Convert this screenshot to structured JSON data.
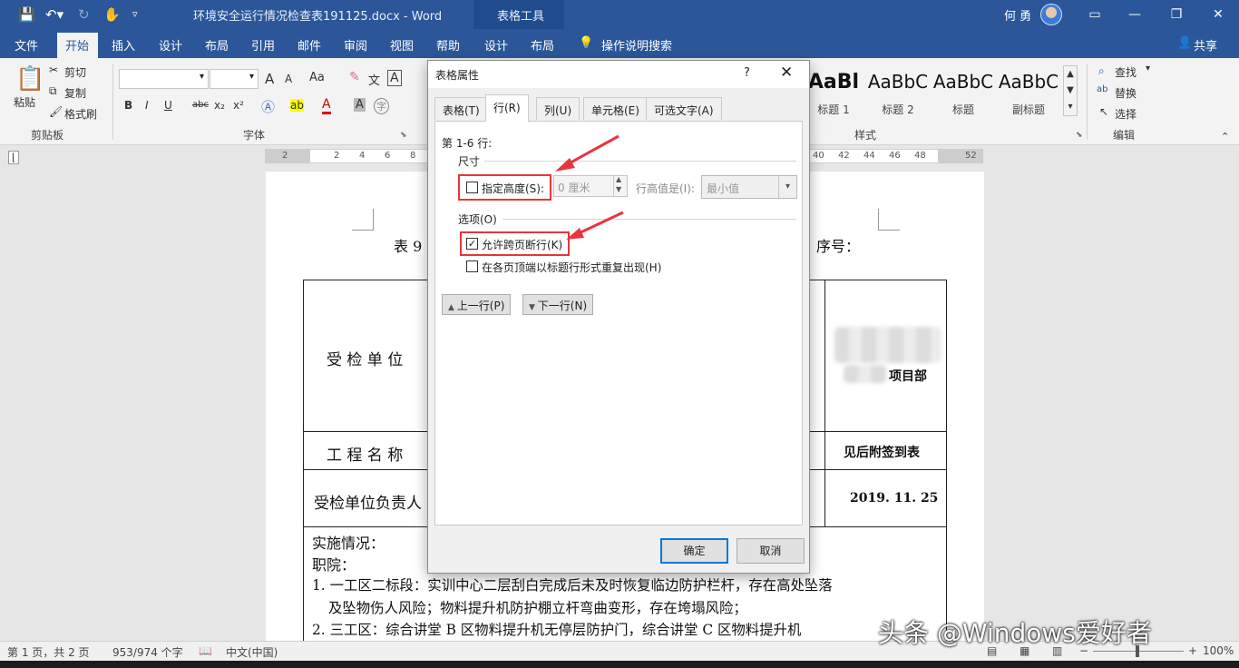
{
  "titlebar": {
    "doc_title": "环境安全运行情况检查表191125.docx  -  Word",
    "table_tools": "表格工具",
    "user_name": "何 勇"
  },
  "tabs": [
    "文件",
    "开始",
    "插入",
    "设计",
    "布局",
    "引用",
    "邮件",
    "审阅",
    "视图",
    "帮助",
    "设计",
    "布局",
    "操作说明搜索"
  ],
  "share_label": "共享",
  "ribbon": {
    "clipboard": {
      "paste": "粘贴",
      "cut": "剪切",
      "copy": "复制",
      "format_painter": "格式刷",
      "label": "剪贴板"
    },
    "font": {
      "label": "字体",
      "bold": "B",
      "italic": "I",
      "underline": "U",
      "strike": "abc",
      "sub": "x₂",
      "sup": "x²",
      "case": "Aa",
      "grow": "A",
      "shrink": "A",
      "font_color": "A",
      "highlight": "ab",
      "char_shade": "A",
      "char_border": "A",
      "phonetic": "文",
      "enclose": "字"
    },
    "styles": {
      "label": "样式",
      "items": [
        {
          "sample": "AaBl",
          "name": "标题 1"
        },
        {
          "sample": "AaBbC",
          "name": "标题 2"
        },
        {
          "sample": "AaBbC",
          "name": "标题"
        },
        {
          "sample": "AaBbC",
          "name": "副标题"
        }
      ]
    },
    "editing": {
      "find": "查找",
      "replace": "替换",
      "select": "选择",
      "label": "编辑"
    }
  },
  "ruler": {
    "left_numbers": [
      "2",
      "2",
      "4",
      "6",
      "8"
    ],
    "right_numbers": [
      "40",
      "42",
      "44",
      "46",
      "48",
      "52"
    ]
  },
  "document": {
    "title_left": "表 9",
    "title_right": "序号：",
    "row1_label": "受 检 单 位",
    "row1_value": "项目部",
    "row2_label": "工 程 名 称",
    "row2_value": "见后附签到表",
    "row3_label": "受检单位负责人",
    "row3_value": "2019. 11. 25",
    "body_lines": [
      "实施情况：",
      "职院：",
      "1. 一工区二标段：实训中心二层刮白完成后未及时恢复临边防护栏杆，存在高处坠落",
      "及坠物伤人风险；物料提升机防护棚立杆弯曲变形，存在垮塌风险；",
      "2. 三工区：综合讲堂 B 区物料提升机无停层防护门，综合讲堂 C 区物料提升机"
    ]
  },
  "dialog": {
    "title": "表格属性",
    "help": "?",
    "tabs": [
      "表格(T)",
      "行(R)",
      "列(U)",
      "单元格(E)",
      "可选文字(A)"
    ],
    "rows_header": "第 1-6 行:",
    "size_label": "尺寸",
    "specify_height": "指定高度(S):",
    "specify_height_checked": false,
    "height_value": "0 厘米",
    "row_height_is": "行高值是(I):",
    "row_height_rule": "最小值",
    "options_label": "选项(O)",
    "allow_break": "允许跨页断行(K)",
    "allow_break_checked": true,
    "repeat_header": "在各页顶端以标题行形式重复出现(H)",
    "repeat_header_checked": false,
    "prev_row": "上一行(P)",
    "next_row": "下一行(N)",
    "ok": "确定",
    "cancel": "取消"
  },
  "statusbar": {
    "page": "第 1 页，共 2 页",
    "words": "953/974 个字",
    "language": "中文(中国)",
    "zoom": "100%"
  },
  "watermark": "头条 @Windows爱好者",
  "colors": {
    "accent": "#2b579a",
    "highlight": "#e8343c"
  }
}
